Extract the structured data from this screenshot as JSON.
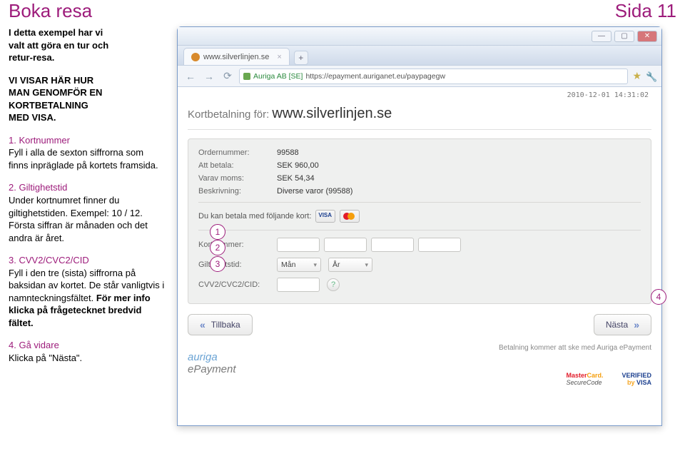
{
  "header": {
    "title": "Boka resa",
    "page": "Sida 11"
  },
  "intro": {
    "line1": "I detta exempel har vi",
    "line2": "valt att göra en tur och",
    "line3": "retur-resa.",
    "sub1": "VI VISAR HÄR HUR",
    "sub2": "MAN GENOMFÖR EN",
    "sub3": "KORTBETALNING",
    "sub4": "MED VISA."
  },
  "steps": {
    "s1": {
      "num": "1.",
      "title": "Kortnummer",
      "body": "Fyll i alla de sexton siffrorna som finns inpräglade på kortets framsida."
    },
    "s2": {
      "num": "2.",
      "title": "Giltighetstid",
      "body": "Under kortnumret finner du giltighetstiden. Exempel: 10 / 12. Första siffran är månaden och det andra är året."
    },
    "s3": {
      "num": "3.",
      "title": "CVV2/CVC2/CID",
      "body1": "Fyll i den tre (sista) siffrorna på baksidan av kortet. De står vanligtvis i namnteckningsfältet. ",
      "bold": "För mer info klicka på frågetecknet bredvid fältet."
    },
    "s4": {
      "num": "4.",
      "title": "Gå vidare",
      "body": "Klicka på \"Nästa\"."
    }
  },
  "browser": {
    "tab_label": "www.silverlinjen.se",
    "tab_plus": "+",
    "addr_org": "Auriga AB [SE]",
    "addr_url": "https://epayment.auriganet.eu/paypagegw",
    "timestamp": "2010-12-01 14:31:02"
  },
  "payment": {
    "header_prefix": "Kortbetalning för:",
    "header_site": "www.silverlinjen.se",
    "labels": {
      "order": "Ordernummer:",
      "amount": "Att betala:",
      "vat": "Varav moms:",
      "desc": "Beskrivning:",
      "paymethods": "Du kan betala med följande kort:",
      "cardno": "Kortnummer:",
      "expiry": "Giltighetstid:",
      "cvv": "CVV2/CVC2/CID:"
    },
    "values": {
      "order": "99588",
      "amount": "SEK 960,00",
      "vat": "SEK 54,34",
      "desc": "Diverse varor (99588)",
      "month": "Mån",
      "year": "År",
      "question": "?"
    },
    "buttons": {
      "back": "Tillbaka",
      "next": "Nästa"
    },
    "note": "Betalning kommer att ske med Auriga ePayment",
    "logos": {
      "auriga1": "auriga",
      "auriga2": "ePayment",
      "mcsec1": "MasterCard.",
      "mcsec2": "SecureCode",
      "vbv1": "VERIFIED",
      "vbv2": "by VISA"
    }
  },
  "callouts": {
    "c1": "1",
    "c2": "2",
    "c3": "3",
    "c4": "4"
  }
}
